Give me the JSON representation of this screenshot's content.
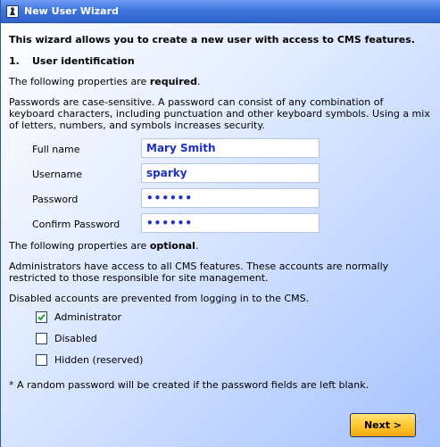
{
  "window": {
    "title": "New User Wizard",
    "icon": "wizard-icon"
  },
  "intro": "This wizard allows you to create a new user with access to CMS features.",
  "section": {
    "number": "1.",
    "title": "User identification"
  },
  "required_note": {
    "prefix": "The following properties are ",
    "emphasis": "required",
    "suffix": "."
  },
  "password_help": "Passwords are case-sensitive. A password can consist of any combination of keyboard characters, including punctuation and other keyboard symbols. Using a mix of letters, numbers, and symbols increases security.",
  "fields": {
    "full_name": {
      "label": "Full name",
      "value": "Mary Smith"
    },
    "username": {
      "label": "Username",
      "value": "sparky"
    },
    "password": {
      "label": "Password",
      "value": "secret"
    },
    "confirm_password": {
      "label": "Confirm Password",
      "value": "secret"
    }
  },
  "optional_note": {
    "prefix": "The following properties are ",
    "emphasis": "optional",
    "suffix": "."
  },
  "admin_help": "Administrators have access to all CMS features. These accounts are normally restricted to those responsible for site management.",
  "disabled_help": "Disabled accounts are prevented from logging in to the CMS.",
  "checkboxes": {
    "administrator": {
      "label": "Administrator",
      "checked": true
    },
    "disabled": {
      "label": "Disabled",
      "checked": false
    },
    "hidden": {
      "label": "Hidden (reserved)",
      "checked": false
    }
  },
  "footnote": "* A random password will be created if the password fields are left blank.",
  "buttons": {
    "next": "Next >"
  },
  "colors": {
    "title_bar": "#3f76dd",
    "accent_text": "#1a2fcc",
    "button": "#ffc42a",
    "check": "#2e9a2e"
  }
}
